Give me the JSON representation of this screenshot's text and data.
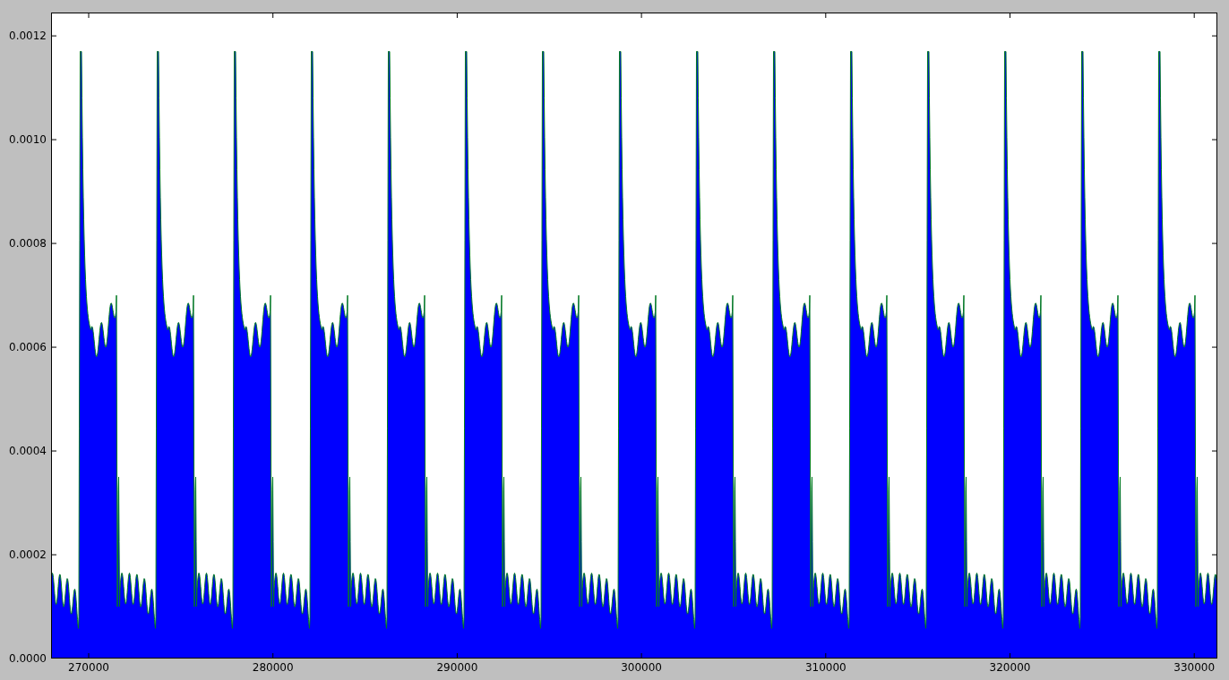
{
  "figure": {
    "y_tick_labels": [
      "0.0012",
      "0.0010",
      "0.0008",
      "0.0006",
      "0.0004",
      "0.0002",
      "0.0000"
    ],
    "x_tick_labels": [
      "270000",
      "280000",
      "290000",
      "300000",
      "310000",
      "320000",
      "330000"
    ]
  }
}
